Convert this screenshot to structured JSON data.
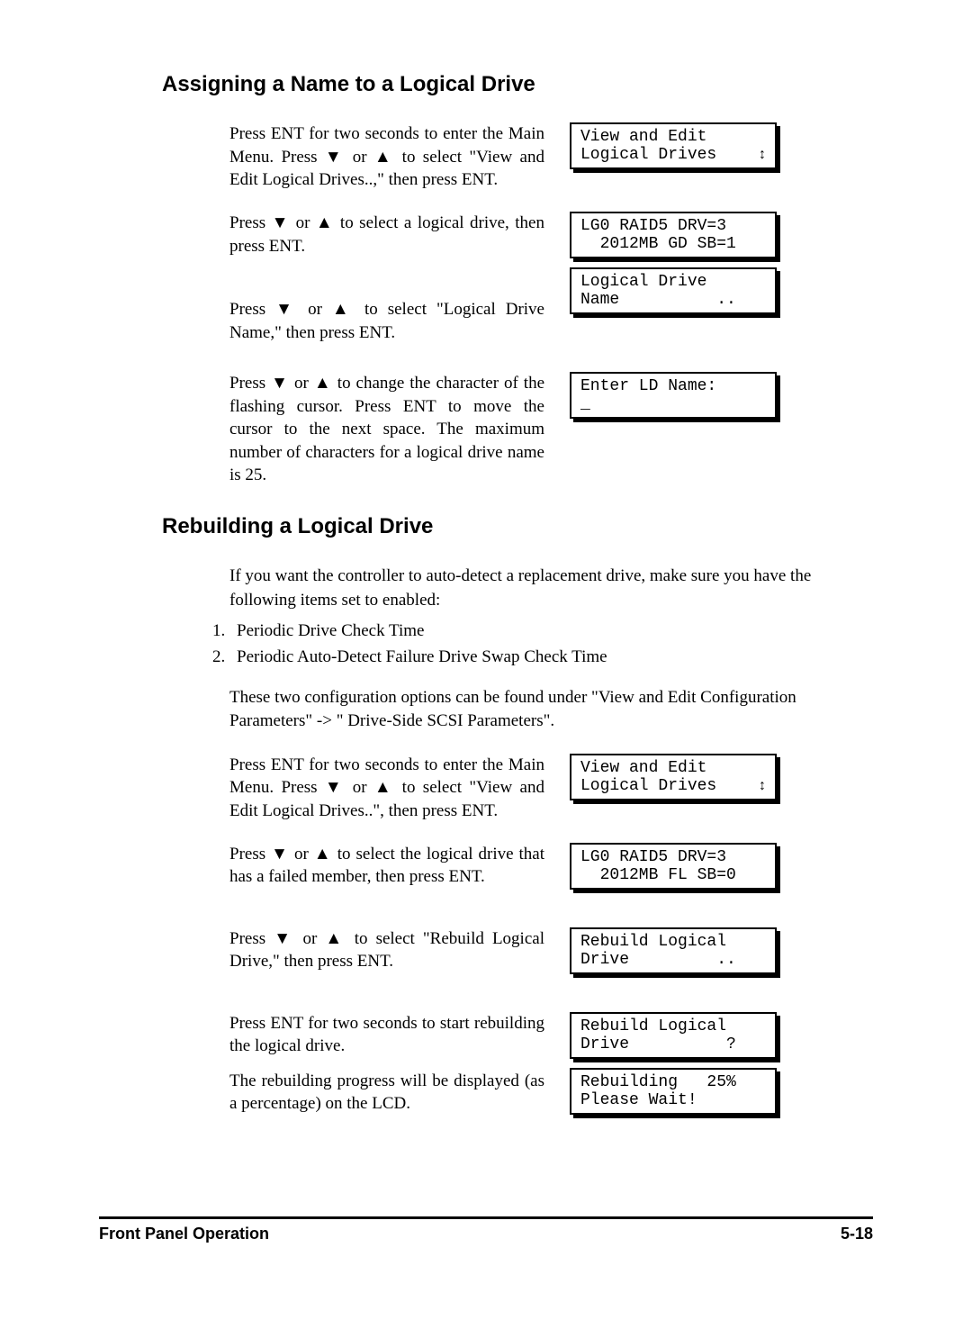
{
  "section1": {
    "heading": "Assigning a Name to a Logical Drive",
    "steps": {
      "s1": "Press ENT for two seconds to enter the Main Menu.  Press ▼ or ▲ to select \"View and Edit Logical Drives..,\" then press ENT.",
      "s2": "Press ▼ or ▲ to select a logical drive, then press ENT.",
      "s3": "Press ▼ or ▲ to select \"Logical Drive Name,\" then press ENT.",
      "s4": "Press ▼ or ▲ to change the character of the flashing cursor.  Press ENT to move the cursor to the next space. The maximum number of characters for a logical drive name is 25."
    },
    "lcds": {
      "l1a": "View and Edit",
      "l1b": "Logical Drives",
      "l2a": "LG0 RAID5 DRV=3",
      "l2b": "  2012MB GD SB=1",
      "l3a": "Logical Drive",
      "l3b": "Name          ..",
      "l4a": "Enter LD Name:",
      "l4b": "_"
    }
  },
  "section2": {
    "heading": "Rebuilding a Logical Drive",
    "intro": "If you want the controller to auto-detect a replacement drive, make sure you have the following items set to enabled:",
    "list": {
      "i1": "Periodic Drive Check Time",
      "i2": "Periodic Auto-Detect Failure Drive Swap Check Time"
    },
    "intro2": "These two configuration options can be found under \"View and Edit Configuration Parameters\" -> \" Drive-Side SCSI Parameters\".",
    "steps": {
      "s1": "Press ENT for two seconds to enter the Main Menu.  Press ▼ or ▲ to select \"View and Edit Logical Drives..\", then press ENT.",
      "s2": "Press ▼ or ▲ to select the logical drive that has a failed member, then press ENT.",
      "s3": "Press ▼ or ▲ to select \"Rebuild Logical Drive,\" then press ENT.",
      "s4": "Press ENT for two seconds to start rebuilding the logical drive.",
      "s5": "The rebuilding progress will be displayed (as a percentage) on the LCD."
    },
    "lcds": {
      "l1a": "View and Edit",
      "l1b": "Logical Drives",
      "l2a": "LG0 RAID5 DRV=3",
      "l2b": "  2012MB FL SB=0",
      "l3a": "Rebuild Logical",
      "l3b": "Drive         ..",
      "l4a": "Rebuild Logical",
      "l4b": "Drive          ?",
      "l5a": "Rebuilding   25%",
      "l5b": "Please Wait!"
    }
  },
  "footer": {
    "left": "Front Panel Operation",
    "right": "5-18"
  }
}
